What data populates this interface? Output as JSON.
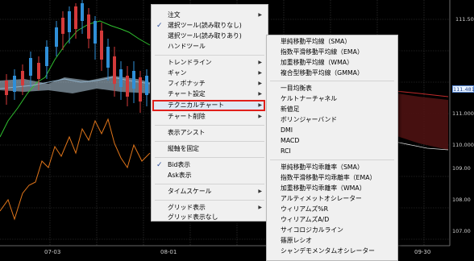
{
  "chart": {
    "price_axis": [
      "111.50",
      "111.000",
      "110.000",
      "109.00",
      "108.00",
      "107.00"
    ],
    "price_flag": "111.481",
    "dates": [
      "07-03",
      "08-01",
      "09-30"
    ]
  },
  "main_menu": {
    "items": [
      {
        "label": "注文",
        "submenu": true,
        "checked": false
      },
      {
        "label": "選択ツール(読み取りなし)",
        "submenu": false,
        "checked": true
      },
      {
        "label": "選択ツール(読み取りあり)",
        "submenu": false,
        "checked": false
      },
      {
        "label": "ハンドツール",
        "submenu": false,
        "checked": false
      },
      {
        "label": "トレンドライン",
        "submenu": true,
        "checked": false
      },
      {
        "label": "ギャン",
        "submenu": true,
        "checked": false
      },
      {
        "label": "フィボナッチ",
        "submenu": true,
        "checked": false
      },
      {
        "label": "チャート設定",
        "submenu": true,
        "checked": false
      },
      {
        "label": "テクニカルチャート",
        "submenu": true,
        "checked": false,
        "highlighted": true
      },
      {
        "label": "チャート削除",
        "submenu": true,
        "checked": false
      },
      {
        "label": "表示アシスト",
        "submenu": false,
        "checked": false
      },
      {
        "label": "縦軸を固定",
        "submenu": false,
        "checked": false
      },
      {
        "label": "Bid表示",
        "submenu": false,
        "checked": true
      },
      {
        "label": "Ask表示",
        "submenu": false,
        "checked": false
      },
      {
        "label": "タイムスケール",
        "submenu": true,
        "checked": false
      },
      {
        "label": "グリッド表示",
        "submenu": true,
        "checked": false
      },
      {
        "label": "グリッド表示なし",
        "submenu": false,
        "checked": false
      }
    ]
  },
  "sub_menu": {
    "items": [
      "単純移動平均線（SMA）",
      "指数平滑移動平均線（EMA）",
      "加重移動平均線（WMA）",
      "複合型移動平均線（GMMA）",
      "一目均衡表",
      "ケルトナーチャネル",
      "新値足",
      "ボリンジャーバンド",
      "DMI",
      "MACD",
      "RCI",
      "単純移動平均乖離率（SMA）",
      "指数平滑移動平均乖離率（EMA）",
      "加重移動平均乖離率（WMA）",
      "アルティメットオシレーター",
      "ウィリアムズ%R",
      "ウィリアムズA/D",
      "サイコロジカルライン",
      "篠原レシオ",
      "シャンデモメンタムオシレーター"
    ]
  },
  "colors": {
    "up_candle": "#2f8fd8",
    "down_candle": "#d43a3a",
    "green_line": "#2fbf2f",
    "orange_line": "#e0751a",
    "cloud": "#5a1414"
  }
}
